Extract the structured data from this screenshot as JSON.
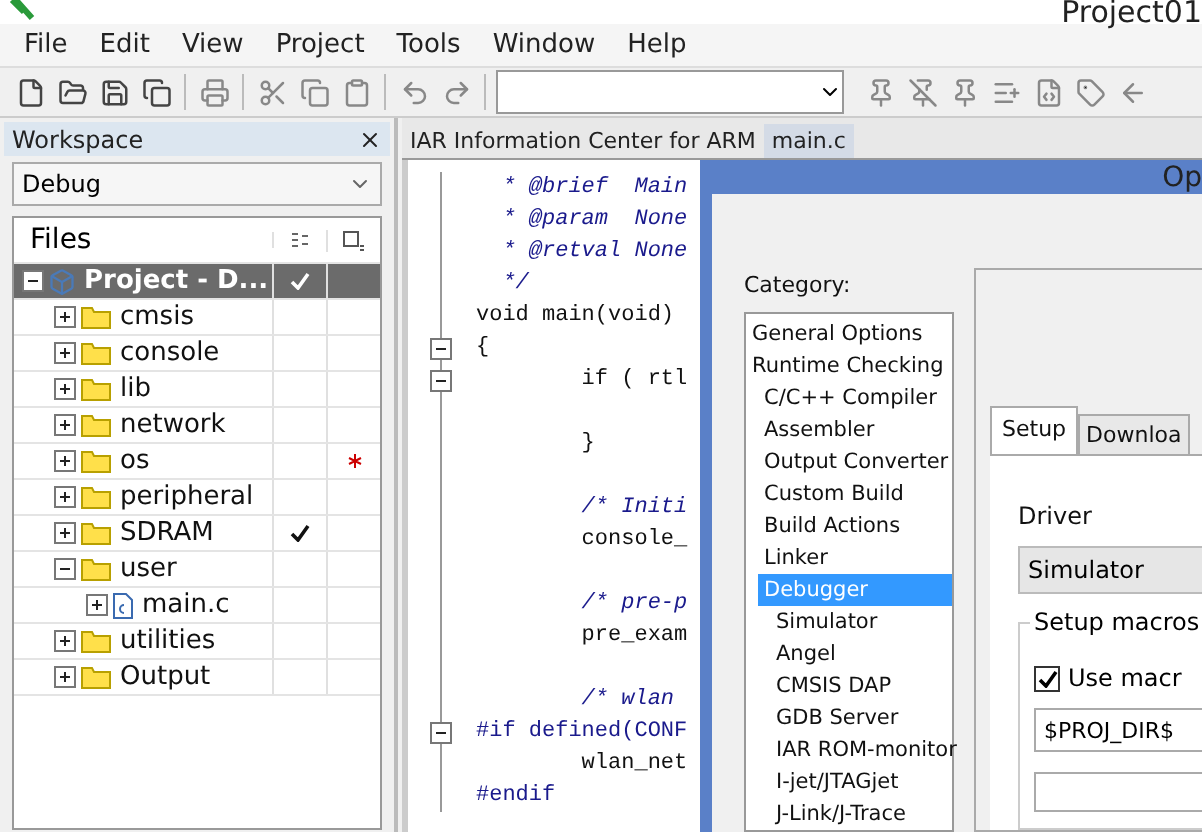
{
  "window": {
    "title": "Project01"
  },
  "menu": [
    "File",
    "Edit",
    "View",
    "Project",
    "Tools",
    "Window",
    "Help"
  ],
  "workspace": {
    "title": "Workspace",
    "config": "Debug",
    "files_header": "Files",
    "tree": {
      "name": "Project - D...",
      "kind": "project",
      "expanded": true,
      "selected": true,
      "checked": true,
      "starred": false,
      "children": [
        {
          "name": "cmsis",
          "kind": "folder",
          "expanded": false,
          "selected": false,
          "checked": false,
          "starred": false
        },
        {
          "name": "console",
          "kind": "folder",
          "expanded": false,
          "selected": false,
          "checked": false,
          "starred": false
        },
        {
          "name": "lib",
          "kind": "folder",
          "expanded": false,
          "selected": false,
          "checked": false,
          "starred": false
        },
        {
          "name": "network",
          "kind": "folder",
          "expanded": false,
          "selected": false,
          "checked": false,
          "starred": false
        },
        {
          "name": "os",
          "kind": "folder",
          "expanded": false,
          "selected": false,
          "checked": false,
          "starred": true
        },
        {
          "name": "peripheral",
          "kind": "folder",
          "expanded": false,
          "selected": false,
          "checked": false,
          "starred": false
        },
        {
          "name": "SDRAM",
          "kind": "folder",
          "expanded": false,
          "selected": false,
          "checked": true,
          "starred": false
        },
        {
          "name": "user",
          "kind": "folder",
          "expanded": true,
          "selected": false,
          "checked": false,
          "starred": false,
          "children": [
            {
              "name": "main.c",
              "kind": "file",
              "expanded": false,
              "selected": false,
              "checked": false,
              "starred": false
            }
          ]
        },
        {
          "name": "utilities",
          "kind": "folder",
          "expanded": false,
          "selected": false,
          "checked": false,
          "starred": false
        },
        {
          "name": "Output",
          "kind": "folder",
          "expanded": false,
          "selected": false,
          "checked": false,
          "starred": false
        }
      ]
    }
  },
  "editor": {
    "tabs": [
      {
        "label": "IAR Information Center for ARM",
        "selected": false
      },
      {
        "label": "main.c",
        "selected": true
      }
    ],
    "lines": [
      {
        "text": "  * @brief  Main",
        "kind": "comment",
        "fold": false
      },
      {
        "text": "  * @param  None",
        "kind": "comment",
        "fold": false
      },
      {
        "text": "  * @retval None",
        "kind": "comment",
        "fold": false
      },
      {
        "text": "  */",
        "kind": "comment",
        "fold": false
      },
      {
        "text": "void main(void)",
        "kind": "code",
        "fold": false
      },
      {
        "text": "{",
        "kind": "code",
        "fold": true
      },
      {
        "text": "        if ( rtl",
        "kind": "code",
        "fold": true
      },
      {
        "fold": false
      },
      {
        "text": "        }",
        "kind": "code",
        "fold": false
      },
      {
        "fold": false
      },
      {
        "text": "        /* Initi",
        "kind": "comment",
        "fold": false
      },
      {
        "text": "        console_",
        "kind": "code",
        "fold": false
      },
      {
        "fold": false
      },
      {
        "text": "        /* pre-p",
        "kind": "comment",
        "fold": false
      },
      {
        "text": "        pre_exam",
        "kind": "code",
        "fold": false
      },
      {
        "fold": false
      },
      {
        "text": "        /* wlan",
        "kind": "comment",
        "fold": false
      },
      {
        "text": "#if defined(CONF",
        "kind": "preproc",
        "fold": true
      },
      {
        "text": "        wlan_net",
        "kind": "code",
        "fold": false
      },
      {
        "text": "#endif",
        "kind": "preproc",
        "fold": false
      }
    ]
  },
  "dialog": {
    "title": "Op",
    "category_label": "Category:",
    "categories": [
      {
        "label": "General Options",
        "selected": false
      },
      {
        "label": "Runtime Checking",
        "selected": false,
        "children": [
          {
            "label": "C/C++ Compiler",
            "selected": false
          },
          {
            "label": "Assembler",
            "selected": false
          },
          {
            "label": "Output Converter",
            "selected": false
          },
          {
            "label": "Custom Build",
            "selected": false
          },
          {
            "label": "Build Actions",
            "selected": false
          },
          {
            "label": "Linker",
            "selected": false
          },
          {
            "label": "Debugger",
            "selected": true,
            "children": [
              {
                "label": "Simulator",
                "selected": false
              },
              {
                "label": "Angel",
                "selected": false
              },
              {
                "label": "CMSIS DAP",
                "selected": false
              },
              {
                "label": "GDB Server",
                "selected": false
              },
              {
                "label": "IAR ROM-monitor",
                "selected": false
              },
              {
                "label": "I-jet/JTAGjet",
                "selected": false
              },
              {
                "label": "J-Link/J-Trace",
                "selected": false
              }
            ]
          }
        ]
      }
    ],
    "tabs": [
      {
        "label": "Setup",
        "selected": true
      },
      {
        "label": "Downloa",
        "selected": false
      }
    ],
    "driver_label": "Driver",
    "driver": "Simulator",
    "group_label": "Setup macros",
    "use_macro": {
      "label": "Use macr",
      "checked": true
    },
    "macro_path": "$PROJ_DIR$"
  }
}
